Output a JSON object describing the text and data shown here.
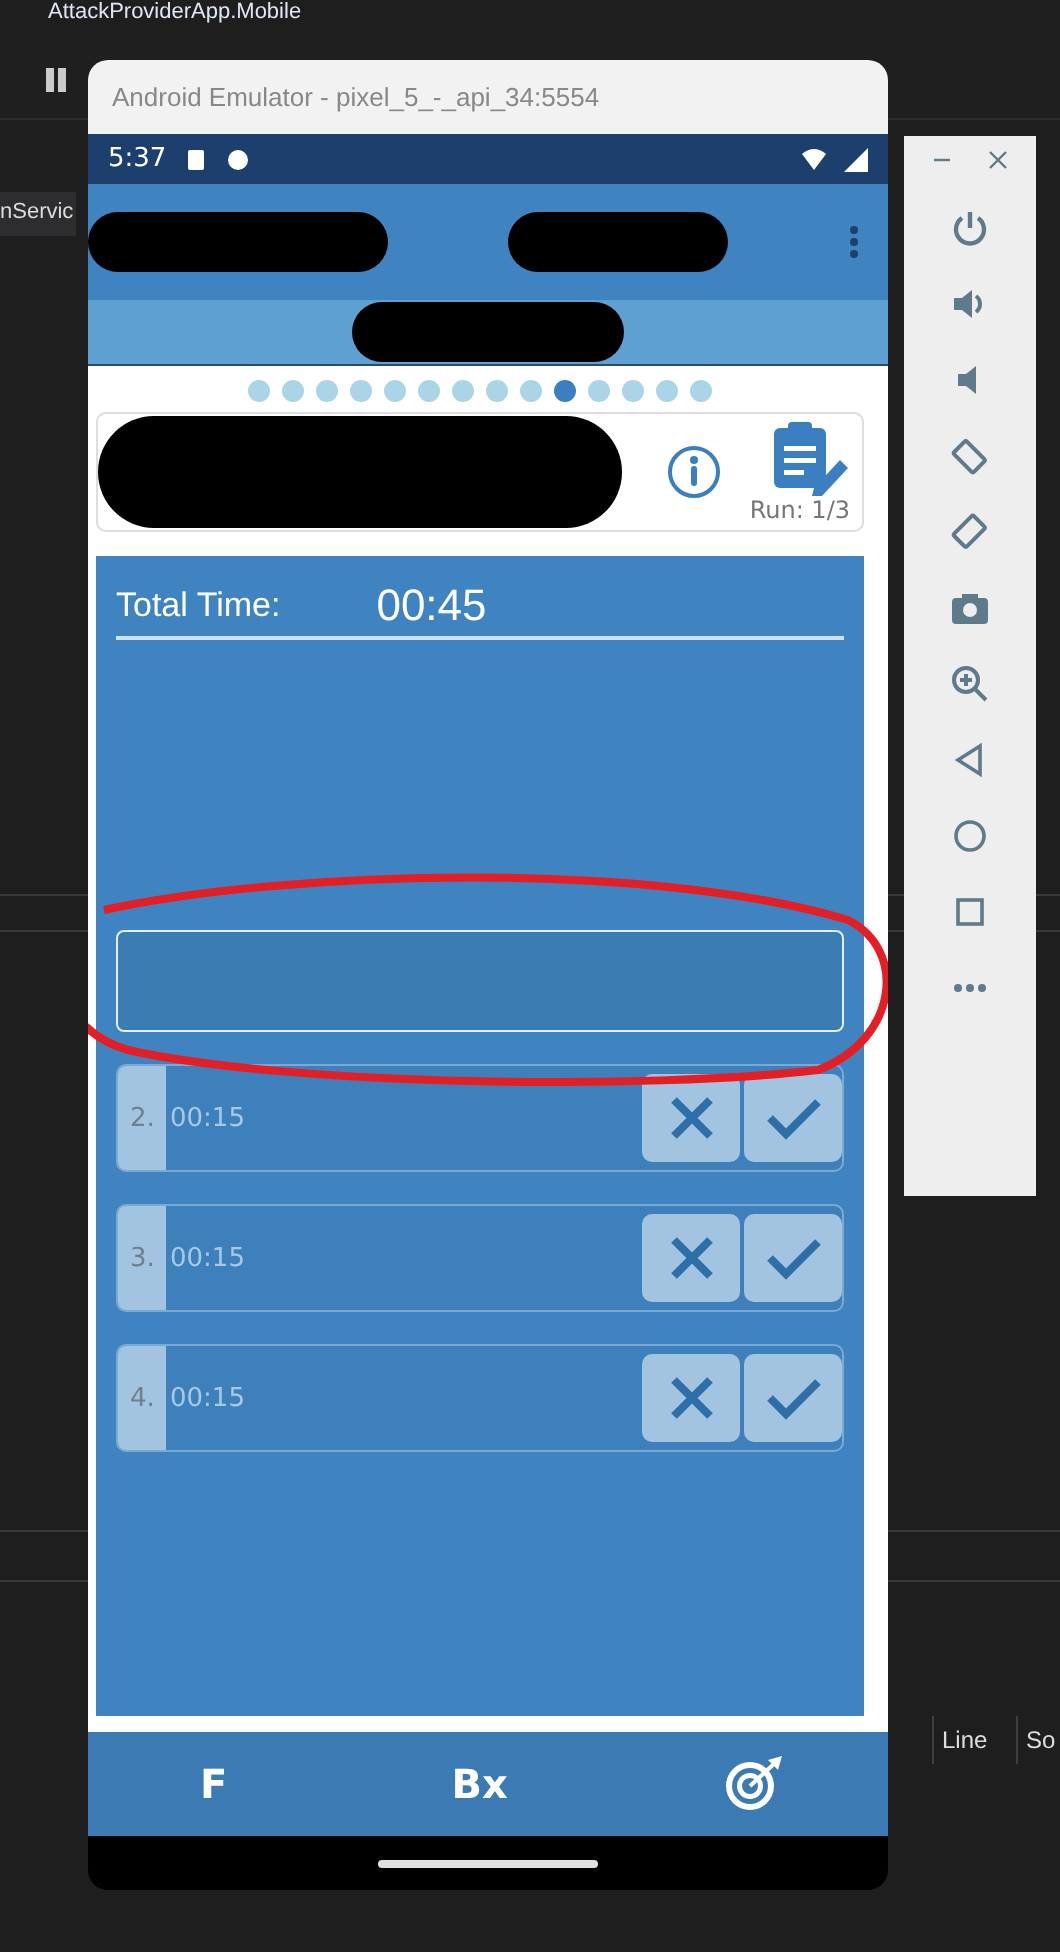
{
  "ide": {
    "title": "AttackProviderApp.Mobile",
    "tab": "nServic",
    "columns": [
      "Line",
      "So"
    ]
  },
  "emulator": {
    "title": "Android Emulator - pixel_5_-_api_34:5554",
    "time": "5:37",
    "dots": [
      {
        "selected": false
      },
      {
        "selected": false
      },
      {
        "selected": false
      },
      {
        "selected": false
      },
      {
        "selected": false
      },
      {
        "selected": false
      },
      {
        "selected": false
      },
      {
        "selected": false
      },
      {
        "selected": false
      },
      {
        "selected": true
      },
      {
        "selected": false
      },
      {
        "selected": false
      },
      {
        "selected": false
      },
      {
        "selected": false
      }
    ],
    "run": "Run: 1/3",
    "total_label": "Total Time:",
    "total_value": "00:45",
    "intervals": [
      {
        "number": "2.",
        "time": "00:15"
      },
      {
        "number": "3.",
        "time": "00:15"
      },
      {
        "number": "4.",
        "time": "00:15"
      }
    ],
    "nav": [
      {
        "kind": "text",
        "label": "F"
      },
      {
        "kind": "text",
        "label": "Bx"
      },
      {
        "kind": "icon"
      }
    ]
  }
}
